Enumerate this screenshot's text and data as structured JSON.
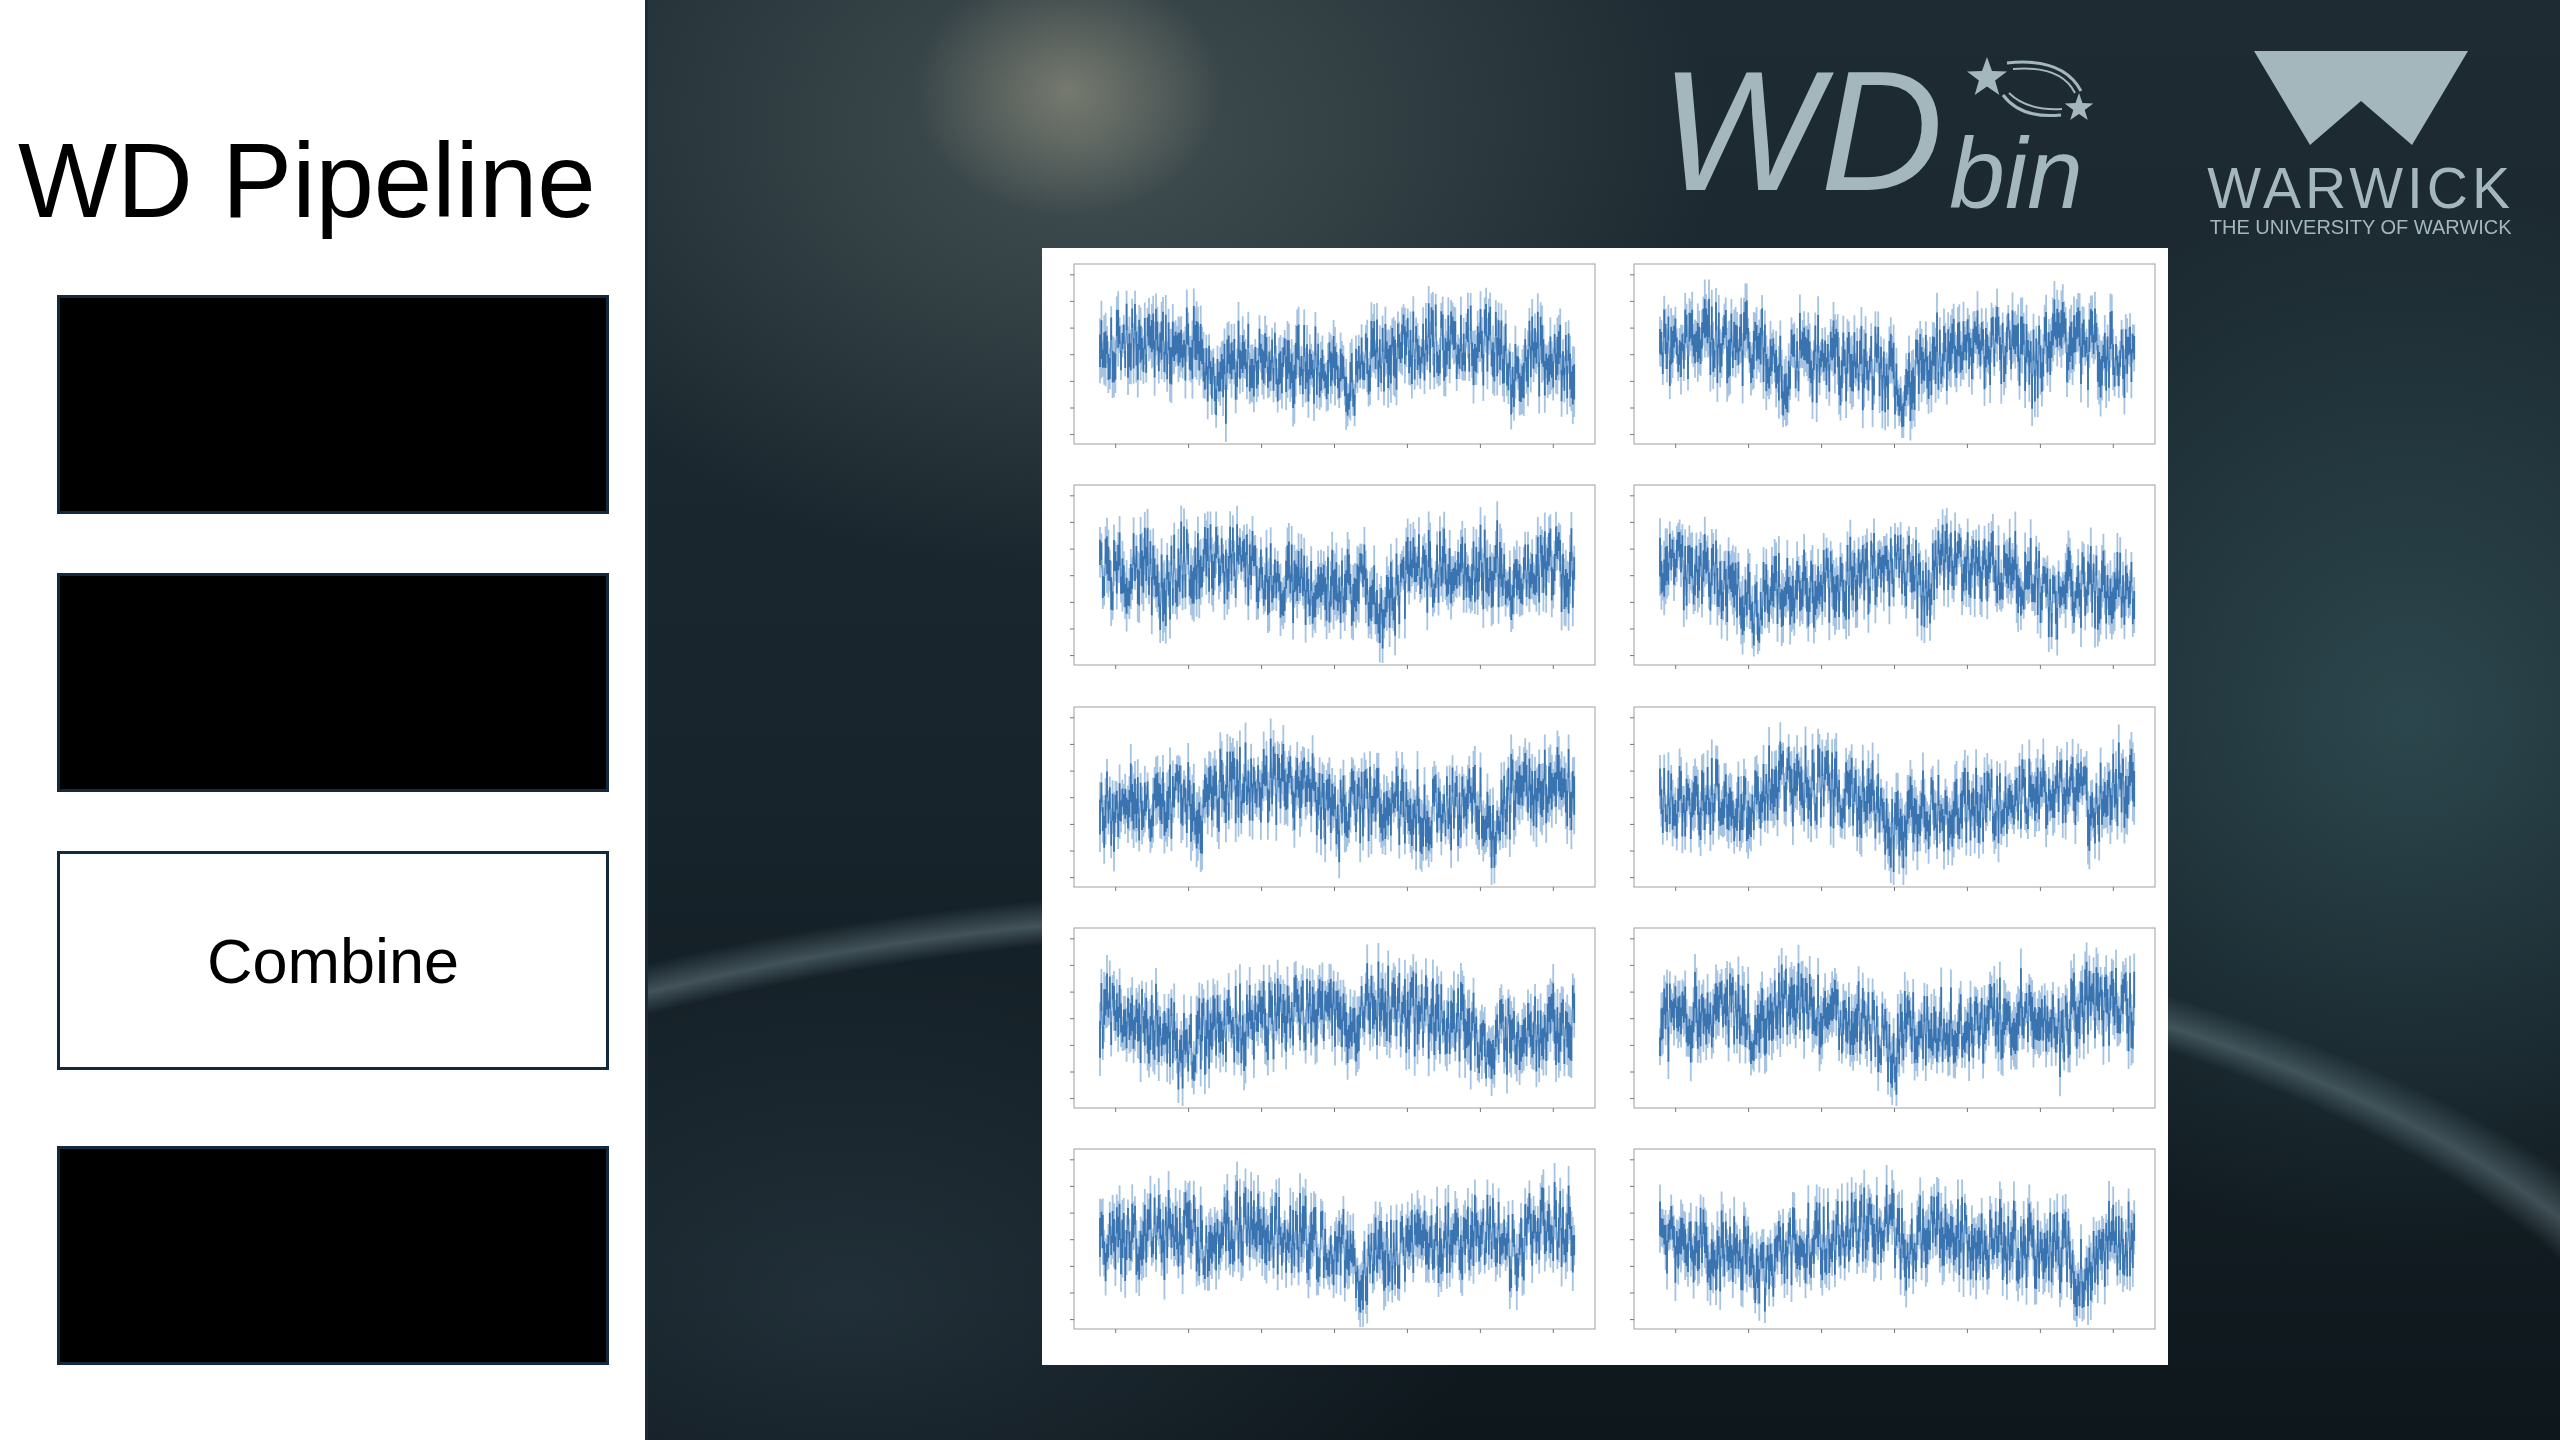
{
  "slide": {
    "title": "WD Pipeline"
  },
  "steps": [
    {
      "revealed": false
    },
    {
      "revealed": false
    },
    {
      "revealed": true,
      "label": "Combine"
    },
    {
      "revealed": false
    }
  ],
  "logos": {
    "wdbin": {
      "main": "WD",
      "suffix": "bin"
    },
    "warwick": {
      "wordmark": "WARWICK",
      "tagline": "THE UNIVERSITY OF WARWICK"
    }
  },
  "figure": {
    "panels": [
      {
        "kind": "light_curve"
      },
      {
        "kind": "light_curve"
      },
      {
        "kind": "light_curve"
      },
      {
        "kind": "light_curve"
      },
      {
        "kind": "light_curve"
      },
      {
        "kind": "light_curve"
      },
      {
        "kind": "light_curve"
      },
      {
        "kind": "light_curve"
      },
      {
        "kind": "light_curve"
      },
      {
        "kind": "light_curve"
      }
    ]
  }
}
